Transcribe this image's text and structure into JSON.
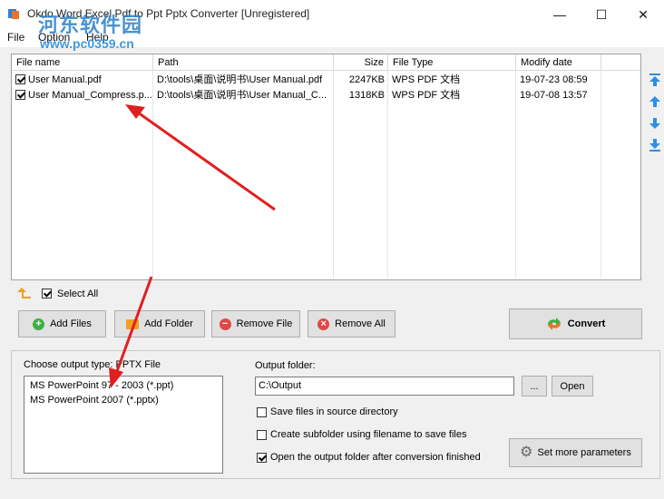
{
  "window": {
    "title": "Okdo Word Excel Pdf to Ppt Pptx Converter [Unregistered]",
    "minimize": "—",
    "maximize": "☐",
    "close": "✕"
  },
  "watermark": {
    "text": "河东软件园",
    "url": "www.pc0359.cn"
  },
  "menu": [
    "File",
    "Option",
    "Help"
  ],
  "table": {
    "columns": [
      "File name",
      "Path",
      "Size",
      "File Type",
      "Modify date"
    ],
    "rows": [
      {
        "checked": true,
        "name": "User Manual.pdf",
        "path": "D:\\tools\\桌面\\说明书\\User Manual.pdf",
        "size": "2247KB",
        "type": "WPS PDF 文档",
        "date": "19-07-23 08:59"
      },
      {
        "checked": true,
        "name": "User Manual_Compress.p...",
        "path": "D:\\tools\\桌面\\说明书\\User Manual_C...",
        "size": "1318KB",
        "type": "WPS PDF 文档",
        "date": "19-07-08 13:57"
      }
    ]
  },
  "select_all": {
    "label": "Select All",
    "checked": true
  },
  "buttons": {
    "add_files": "Add Files",
    "add_folder": "Add Folder",
    "remove_file": "Remove File",
    "remove_all": "Remove All",
    "convert": "Convert"
  },
  "output": {
    "choose_type_label": "Choose output type:  PPTX File",
    "types": [
      "MS PowerPoint 97 - 2003 (*.ppt)",
      "MS PowerPoint 2007 (*.pptx)"
    ],
    "folder_label": "Output folder:",
    "folder_value": "C:\\Output",
    "browse_label": "...",
    "open_label": "Open",
    "save_in_source": {
      "label": "Save files in source directory",
      "checked": false
    },
    "create_subfolder": {
      "label": "Create subfolder using filename to save files",
      "checked": false
    },
    "open_after": {
      "label": "Open the output folder after conversion finished",
      "checked": true
    },
    "set_params": "Set more parameters"
  },
  "colors": {
    "accent_blue": "#2f8ee5",
    "arrow_red": "#e02020",
    "add_green": "#3cb043",
    "remove_red": "#e04848",
    "folder_orange": "#f0a020"
  }
}
